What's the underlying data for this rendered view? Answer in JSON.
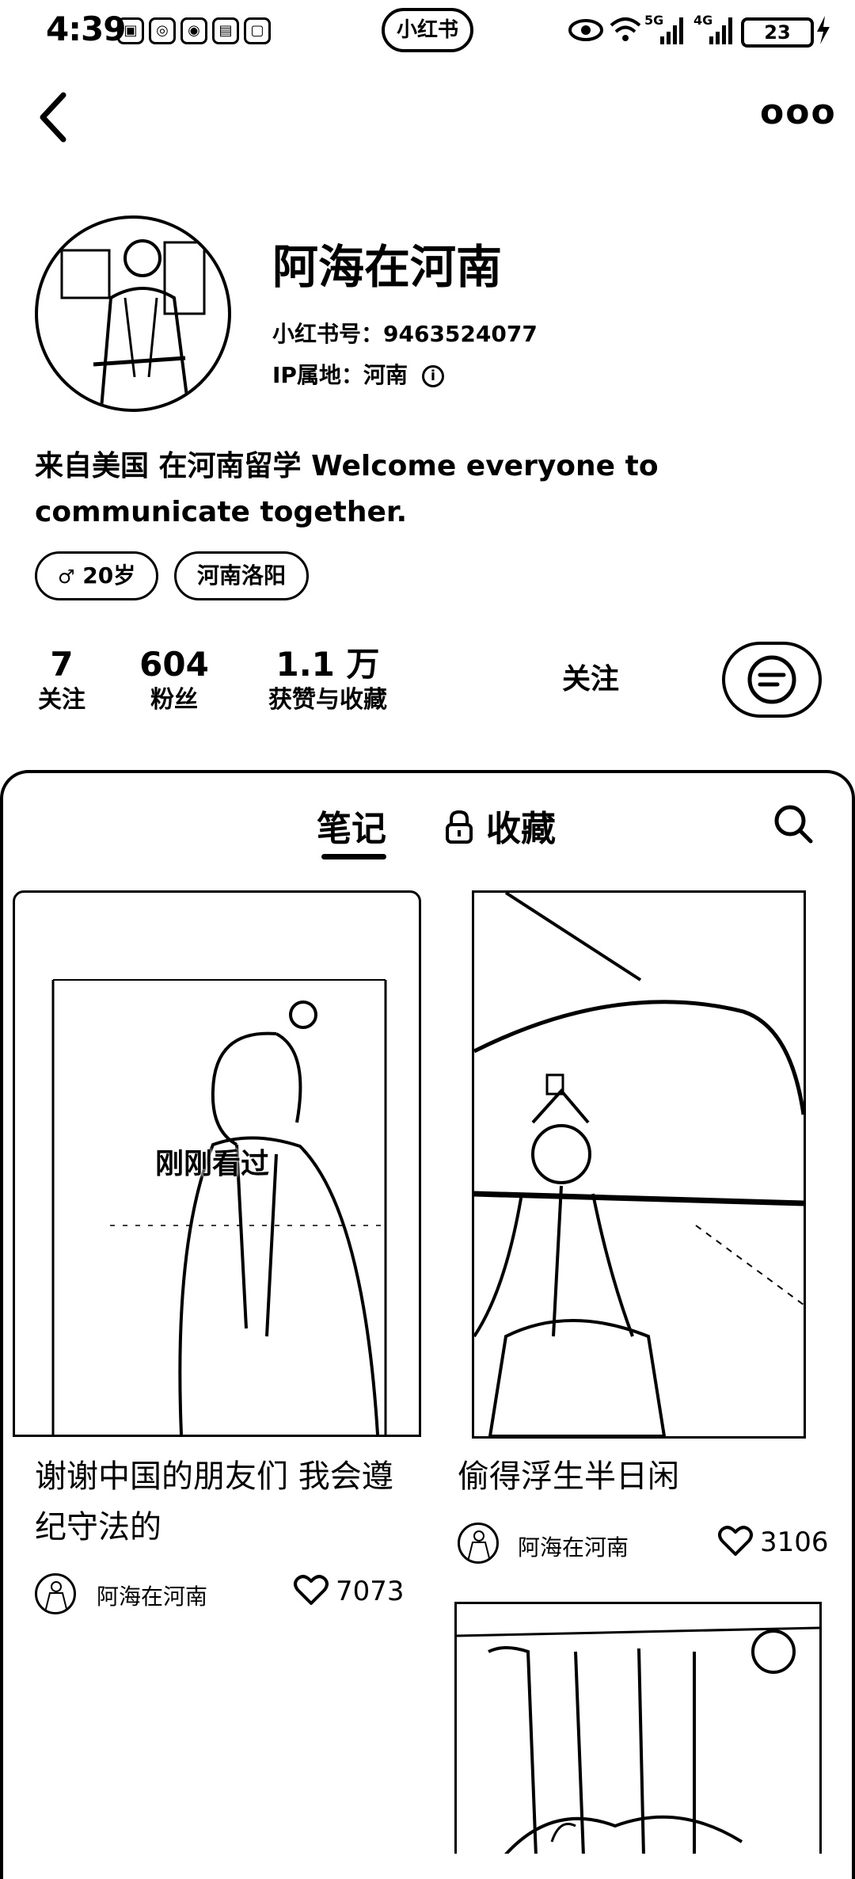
{
  "status_bar": {
    "time": "4:39",
    "app_label": "小红书",
    "net_5g": "5G",
    "net_4g": "4G",
    "battery": "23"
  },
  "header": {
    "more_label": "ooo"
  },
  "profile": {
    "name": "阿海在河南",
    "id_text": "小红书号：9463524077",
    "ip_text": "IP属地：河南",
    "bio": "来自美国 在河南留学 Welcome everyone to communicate together.",
    "tags": [
      "20岁",
      "河南洛阳"
    ],
    "stats": [
      {
        "value": "7",
        "label": "关注"
      },
      {
        "value": "604",
        "label": "粉丝"
      },
      {
        "value": "1.1 万",
        "label": "获赞与收藏"
      }
    ],
    "follow_label": "关注"
  },
  "tabs": {
    "notes": "笔记",
    "collections": "收藏"
  },
  "notes": [
    {
      "title": "谢谢中国的朋友们 我会遵纪守法的",
      "author": "阿海在河南",
      "likes": "7073",
      "overlay": "刚刚看过"
    },
    {
      "title": "偷得浮生半日闲",
      "author": "阿海在河南",
      "likes": "3106"
    }
  ]
}
